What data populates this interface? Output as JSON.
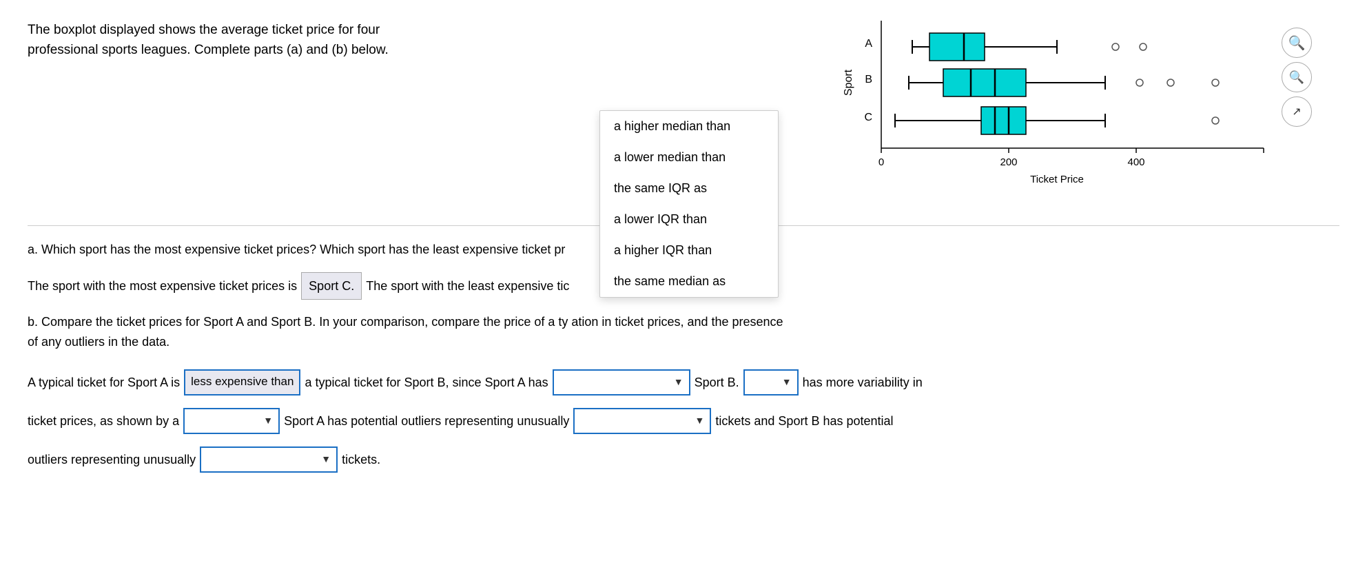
{
  "intro": {
    "text_line1": "The boxplot displayed shows the average ticket price for four",
    "text_line2": "professional sports leagues. Complete parts (a) and (b) below."
  },
  "chart": {
    "title": "Ticket Price",
    "y_label": "Sport",
    "x_axis": [
      0,
      200,
      400
    ],
    "sports": [
      "A",
      "B",
      "C"
    ],
    "accent_color": "#00d4d4"
  },
  "dropdown_overlay": {
    "options": [
      "a higher median than",
      "a lower median than",
      "the same IQR as",
      "a lower IQR than",
      "a higher IQR than",
      "the same median as"
    ]
  },
  "zoom_controls": {
    "zoom_in_label": "⊕",
    "zoom_out_label": "⊖",
    "expand_label": "⤢"
  },
  "section_a": {
    "question": "a. Which sport has the most expensive ticket prices? Which sport has the least expensive ticket pr",
    "answer_prefix": "The sport with the most expensive ticket prices is",
    "sport_c": "Sport C.",
    "answer_suffix": "The sport with the least expensive tic"
  },
  "section_b": {
    "question": "b. Compare the ticket prices for Sport A and Sport B. In your comparison, compare the price of a ty                        ation in ticket prices, and the presence",
    "question_line2": "of any outliers in the data."
  },
  "answer_rows": {
    "row1": {
      "prefix": "A typical ticket for Sport A is",
      "selected_value": "less expensive than",
      "middle": "a typical ticket for Sport B, since Sport A has",
      "dropdown2_value": "",
      "suffix": "Sport B.",
      "dropdown3_value": "",
      "end": "has more variability in"
    },
    "row2": {
      "prefix": "ticket prices, as shown by a",
      "dropdown1_value": "",
      "middle": "Sport A has potential outliers representing unusually",
      "dropdown2_value": "",
      "suffix": "tickets and Sport B has potential"
    },
    "row3": {
      "prefix": "outliers representing unusually",
      "dropdown1_value": "",
      "suffix": "tickets."
    }
  },
  "selects": {
    "placeholder": "",
    "arrow": "▼"
  }
}
